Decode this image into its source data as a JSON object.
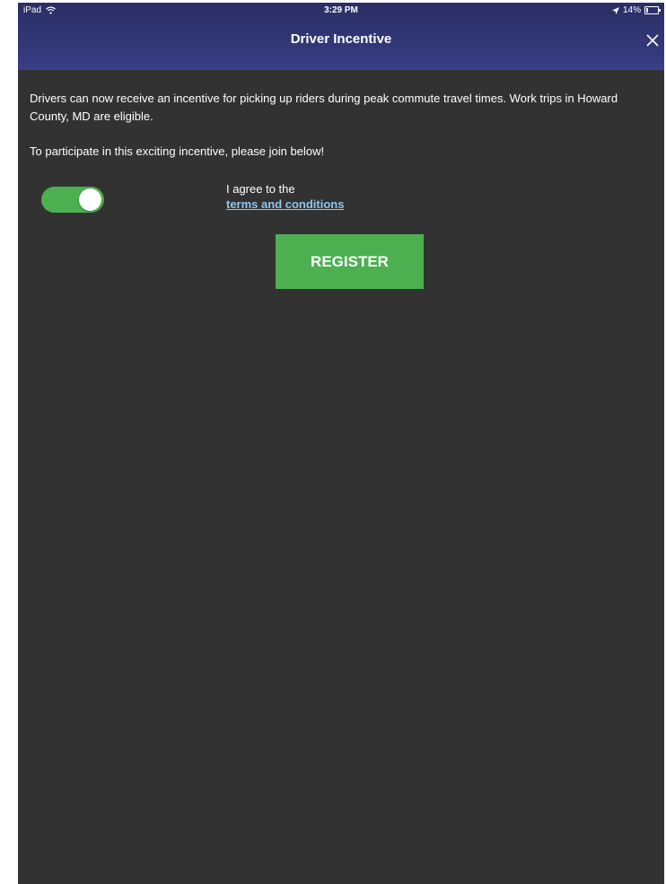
{
  "status_bar": {
    "device": "iPad",
    "time": "3:29 PM",
    "battery": "14%",
    "battery_level": 0.14,
    "icons": [
      "wifi-icon",
      "location-arrow-icon",
      "battery-icon"
    ]
  },
  "nav": {
    "title": "Driver Incentive",
    "close_icon": "close-icon"
  },
  "content": {
    "paragraph_1": "Drivers can now receive an incentive for picking up riders during peak commute travel times. Work trips in Howard County, MD are eligible.",
    "paragraph_2": "To participate in this exciting incentive, please join below!"
  },
  "agreement": {
    "toggle_on": true,
    "label": "I agree to the",
    "link_text": "terms and conditions"
  },
  "register_button": {
    "label": "REGISTER"
  },
  "colors": {
    "header": "#33387a",
    "background": "#323232",
    "accent_green": "#4caf50",
    "link": "#8ec5ee"
  }
}
